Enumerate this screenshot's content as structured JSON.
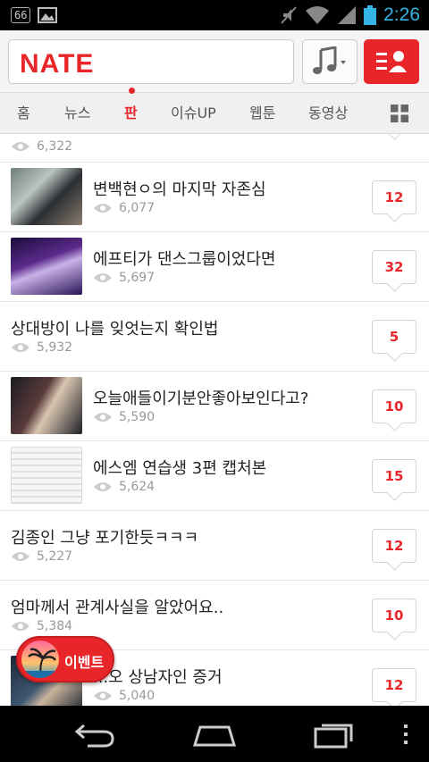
{
  "status_bar": {
    "badge": "66",
    "time": "2:26",
    "icons": [
      "notification-66-icon",
      "image-icon",
      "mute-icon",
      "wifi-icon",
      "signal-icon",
      "battery-icon"
    ]
  },
  "header": {
    "logo": "NATE",
    "search_placeholder": "",
    "music_button_icon": "music-note-icon",
    "profile_button_icon": "user-list-icon"
  },
  "tabs": [
    {
      "label": "홈",
      "active": false
    },
    {
      "label": "뉴스",
      "active": false
    },
    {
      "label": "판",
      "active": true
    },
    {
      "label": "이슈UP",
      "active": false
    },
    {
      "label": "웹툰",
      "active": false
    },
    {
      "label": "동영상",
      "active": false
    }
  ],
  "list": {
    "partial_top_views": "6,322",
    "items": [
      {
        "title": "변백현ㅇ의 마지막 자존심",
        "views": "6,077",
        "comments": "12",
        "has_thumb": true
      },
      {
        "title": "에프티가 댄스그룹이었다면",
        "views": "5,697",
        "comments": "32",
        "has_thumb": true
      },
      {
        "title": "상대방이 나를 잊엇는지 확인법",
        "views": "5,932",
        "comments": "5",
        "has_thumb": false
      },
      {
        "title": "오늘애들이기분안좋아보인다고?",
        "views": "5,590",
        "comments": "10",
        "has_thumb": true
      },
      {
        "title": "에스엠 연습생 3편 캡처본",
        "views": "5,624",
        "comments": "15",
        "has_thumb": true
      },
      {
        "title": "김종인 그냥 포기한듯ㅋㅋㅋ",
        "views": "5,227",
        "comments": "12",
        "has_thumb": false
      },
      {
        "title": "엄마께서 관계사실을 알았어요..",
        "views": "5,384",
        "comments": "10",
        "has_thumb": false
      },
      {
        "title": "...오 상남자인 증거",
        "views": "5,040",
        "comments": "12",
        "has_thumb": true
      }
    ]
  },
  "event_button": {
    "label": "이벤트"
  },
  "nav_bar": {
    "icons": [
      "back-icon",
      "home-icon",
      "recent-apps-icon",
      "menu-icon"
    ]
  },
  "colors": {
    "brand": "#e8262a",
    "clock": "#33b5e5"
  }
}
